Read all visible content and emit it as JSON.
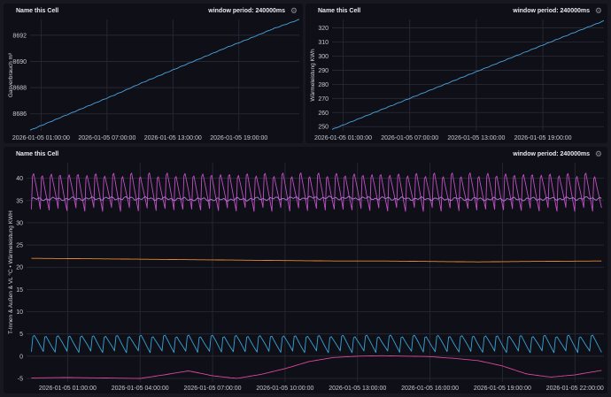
{
  "cells": [
    {
      "name": "Name this Cell",
      "window_period": "window period: 240000ms",
      "settings_icon": "gear-icon"
    },
    {
      "name": "Name this Cell",
      "window_period": "window period: 240000ms",
      "settings_icon": "gear-icon"
    },
    {
      "name": "Name this Cell",
      "window_period": "window period: 240000ms",
      "settings_icon": "gear-icon"
    }
  ],
  "chart_data": [
    {
      "type": "line",
      "title": "",
      "ylabel": "Gasverbrauch m³",
      "xlabel": "",
      "ylim": [
        8684.7,
        8693.2
      ],
      "y_ticks": [
        "8686",
        "8688",
        "8690",
        "8692"
      ],
      "y_tick_values": [
        8686,
        8688,
        8690,
        8692
      ],
      "x_ticks": [
        "2026-01-05 01:00:00",
        "2026-01-05 07:00:00",
        "2026-01-05 13:00:00",
        "2026-01-05 19:00:00"
      ],
      "x_tick_hours": [
        1,
        7,
        13,
        19
      ],
      "x_range_hours": [
        0,
        24.5
      ],
      "grid": true,
      "series": [
        {
          "color": "#4aa3df",
          "x": [
            0,
            2,
            4,
            6,
            8,
            10,
            12,
            14,
            16,
            18,
            20,
            22,
            24.5
          ],
          "values": [
            8684.75,
            8685.45,
            8686.15,
            8686.85,
            8687.55,
            8688.3,
            8689.0,
            8689.7,
            8690.4,
            8691.1,
            8691.75,
            8692.45,
            8693.2
          ]
        }
      ]
    },
    {
      "type": "line",
      "title": "",
      "ylabel": "Wärmeleistung KWh",
      "xlabel": "",
      "ylim": [
        247,
        326
      ],
      "y_ticks": [
        "250",
        "260",
        "270",
        "280",
        "290",
        "300",
        "310",
        "320"
      ],
      "y_tick_values": [
        250,
        260,
        270,
        280,
        290,
        300,
        310,
        320
      ],
      "x_ticks": [
        "2026-01-05 01:00:00",
        "2026-01-05 07:00:00",
        "2026-01-05 13:00:00",
        "2026-01-05 19:00:00"
      ],
      "x_tick_hours": [
        1,
        7,
        13,
        19
      ],
      "x_range_hours": [
        0,
        24.5
      ],
      "grid": true,
      "series": [
        {
          "color": "#4aa3df",
          "x": [
            0,
            2,
            4,
            6,
            8,
            10,
            12,
            14,
            16,
            18,
            20,
            22,
            24.5
          ],
          "values": [
            248,
            254.3,
            260.6,
            266.9,
            273.2,
            279.5,
            285.8,
            292.1,
            298.4,
            304.7,
            311.0,
            317.3,
            325
          ]
        }
      ]
    },
    {
      "type": "line",
      "title": "",
      "ylabel": "T-Innen & Außen & VL °C • Wärmeleistung KWH",
      "xlabel": "",
      "ylim": [
        -5.8,
        43.5
      ],
      "y_ticks": [
        "-5",
        "0",
        "5",
        "10",
        "15",
        "20",
        "25",
        "30",
        "35",
        "40"
      ],
      "y_tick_values": [
        -5,
        0,
        5,
        10,
        15,
        20,
        25,
        30,
        35,
        40
      ],
      "x_ticks": [
        "2026-01-05 01:00:00",
        "2026-01-05 04:00:00",
        "2026-01-05 07:00:00",
        "2026-01-05 10:00:00",
        "2026-01-05 13:00:00",
        "2026-01-05 16:00:00",
        "2026-01-05 19:00:00",
        "2026-01-05 22:00:00"
      ],
      "x_tick_hours": [
        1,
        4,
        7,
        10,
        13,
        16,
        19,
        22
      ],
      "x_range_hours": [
        -0.7,
        23.2
      ],
      "grid": true,
      "series": [
        {
          "color": "#c04fc4",
          "kind": "oscillation",
          "x_start": -0.5,
          "x_end": 23.1,
          "cycles": 64,
          "values_low_high": [
            33.0,
            41.8
          ]
        },
        {
          "color": "#b478d8",
          "kind": "flat-noise",
          "x_start": -0.5,
          "x_end": 23.1,
          "values": [
            35.3,
            35.5,
            35.2,
            35.6,
            35.4,
            35.3,
            35.5
          ]
        },
        {
          "color": "#e8862f",
          "x": [
            -0.5,
            2,
            4,
            6,
            8,
            10,
            12,
            14,
            16,
            18,
            20,
            23.1
          ],
          "values": [
            22.0,
            21.9,
            21.8,
            21.7,
            21.6,
            21.5,
            21.4,
            21.4,
            21.3,
            21.2,
            21.3,
            21.4
          ]
        },
        {
          "color": "#36a4d8",
          "kind": "oscillation",
          "x_start": -0.5,
          "x_end": 23.1,
          "cycles": 48,
          "values_low_high": [
            1.0,
            5.0
          ]
        },
        {
          "color": "#d9479a",
          "x": [
            -0.5,
            1,
            2.5,
            4,
            5,
            6,
            7,
            8,
            9,
            10,
            11,
            12,
            13,
            14,
            15,
            16,
            17,
            18,
            19,
            20,
            21,
            22,
            23.1
          ],
          "values": [
            -4.9,
            -4.8,
            -4.9,
            -5.0,
            -4.2,
            -3.3,
            -4.4,
            -5.0,
            -4.1,
            -2.8,
            -1.2,
            -0.3,
            0.0,
            0.1,
            0.0,
            -0.1,
            -0.5,
            -1.0,
            -2.2,
            -4.0,
            -4.7,
            -4.2,
            -3.2
          ]
        }
      ]
    }
  ]
}
